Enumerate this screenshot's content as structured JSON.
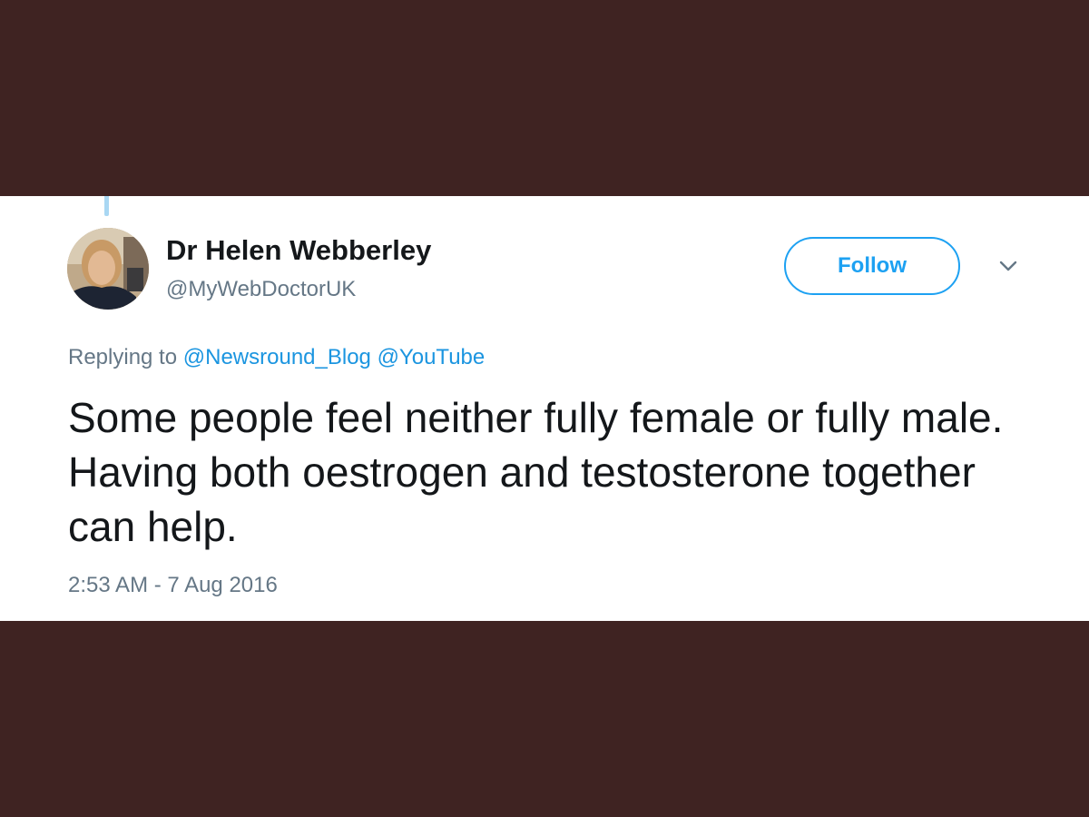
{
  "tweet": {
    "author": {
      "display_name": "Dr Helen Webberley",
      "handle": "@MyWebDoctorUK"
    },
    "follow_label": "Follow",
    "replying_to": {
      "prefix": "Replying to",
      "mentions": [
        "@Newsround_Blog",
        "@YouTube"
      ]
    },
    "text": "Some people feel neither fully female or fully male. Having both oestrogen and testosterone together can help.",
    "timestamp": "2:53 AM - 7 Aug 2016"
  },
  "icons": {
    "menu": "chevron-down-icon",
    "avatar": "profile-photo"
  },
  "colors": {
    "background": "#3f2322",
    "card": "#ffffff",
    "accent": "#1da1f2",
    "link": "#1b95e0",
    "secondary_text": "#657786",
    "primary_text": "#14171a"
  }
}
